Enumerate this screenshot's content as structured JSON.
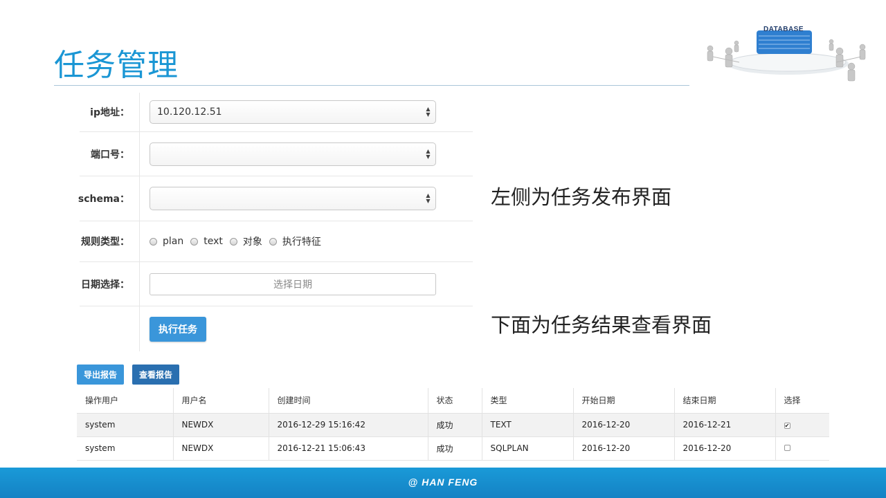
{
  "slide": {
    "title": "任务管理",
    "logo_text": "DATABASE",
    "footer": "@ HAN FENG"
  },
  "form": {
    "ip_label": "ip地址：",
    "ip_value": "10.120.12.51",
    "port_label": "端口号：",
    "port_value": "",
    "schema_label": "schema：",
    "schema_value": "",
    "rule_label": "规则类型：",
    "rule_options": [
      "plan",
      "text",
      "对象",
      "执行特征"
    ],
    "date_label": "日期选择：",
    "date_placeholder": "选择日期",
    "run_button": "执行任务"
  },
  "notes": {
    "left_side": "左侧为任务发布界面",
    "below": "下面为任务结果查看界面"
  },
  "toolbar": {
    "export_label": "导出报告",
    "view_label": "查看报告"
  },
  "table": {
    "headers": [
      "操作用户",
      "用户名",
      "创建时间",
      "状态",
      "类型",
      "开始日期",
      "结束日期",
      "选择"
    ],
    "rows": [
      [
        "system",
        "NEWDX",
        "2016-12-29 15:16:42",
        "成功",
        "TEXT",
        "2016-12-20",
        "2016-12-21"
      ],
      [
        "system",
        "NEWDX",
        "2016-12-21 15:06:43",
        "成功",
        "SQLPLAN",
        "2016-12-20",
        "2016-12-20"
      ]
    ],
    "row_checked": [
      true,
      false
    ]
  },
  "colors": {
    "accent": "#1a96d4",
    "button_primary": "#3a96da",
    "button_dark": "#2a6fb0",
    "footer": "#1a92d2"
  }
}
